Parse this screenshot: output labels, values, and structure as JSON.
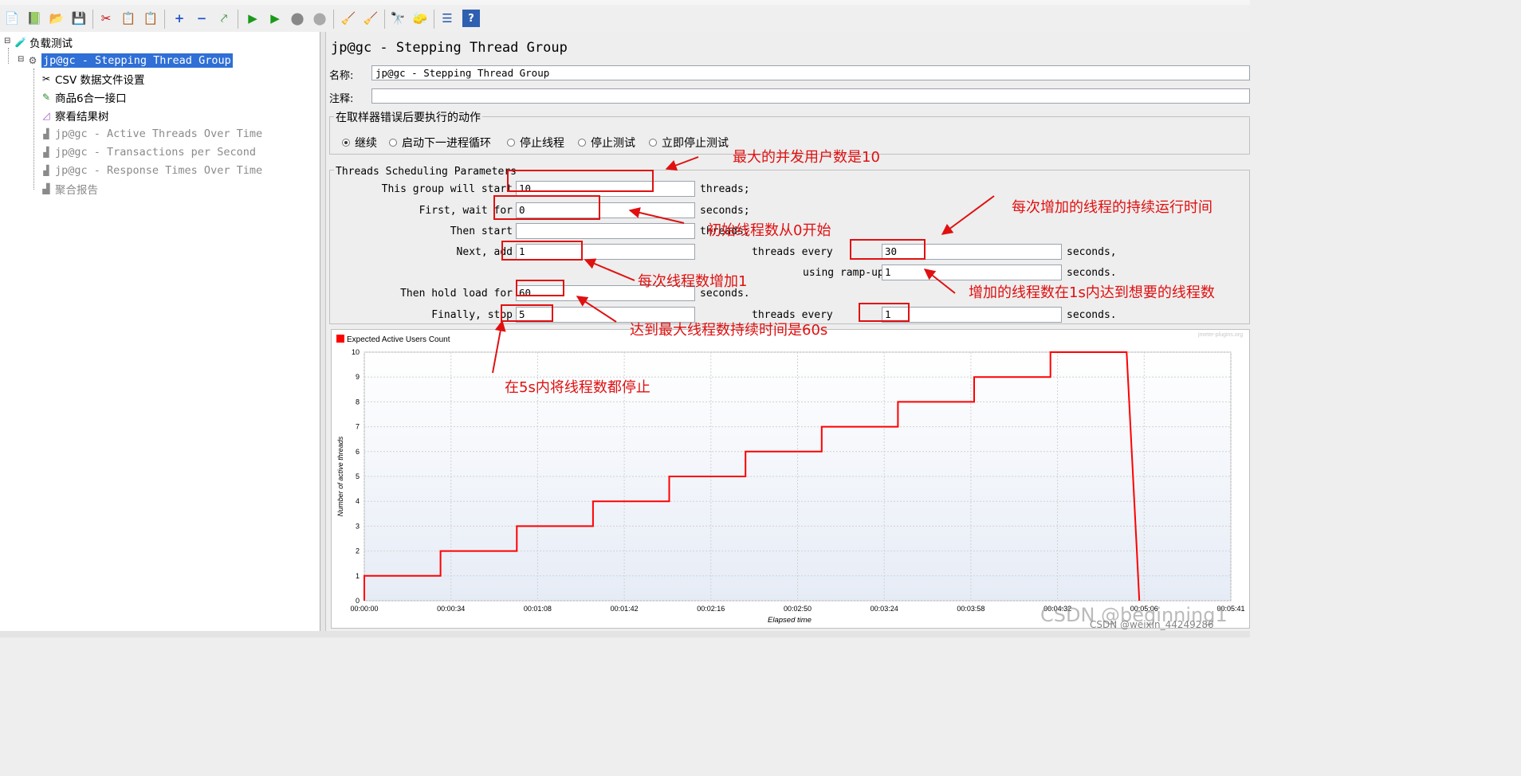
{
  "toolbar": {
    "icons": [
      "new-icon",
      "template-icon",
      "open-icon",
      "save-icon",
      "cut-icon",
      "copy-icon",
      "paste-icon",
      "expand-icon",
      "collapse-icon",
      "toggle-icon",
      "start-icon",
      "start-no-pause-icon",
      "stop-icon",
      "shutdown-icon",
      "clear-icon",
      "clear-all-icon",
      "search-icon",
      "reset-search-icon",
      "function-helper-icon",
      "help-icon"
    ]
  },
  "tree": {
    "root": "负载测试",
    "thread_group": "jp@gc - Stepping Thread Group",
    "children": [
      {
        "label": "CSV 数据文件设置",
        "icon": "csv-config-icon",
        "disabled": false
      },
      {
        "label": "商品6合一接口",
        "icon": "http-sampler-icon",
        "disabled": false
      },
      {
        "label": "察看结果树",
        "icon": "result-tree-icon",
        "disabled": false
      },
      {
        "label": "jp@gc - Active Threads Over Time",
        "icon": "graph-icon",
        "disabled": true
      },
      {
        "label": "jp@gc - Transactions per Second",
        "icon": "graph-icon",
        "disabled": true
      },
      {
        "label": "jp@gc - Response Times Over Time",
        "icon": "graph-icon",
        "disabled": true
      },
      {
        "label": "聚合报告",
        "icon": "graph-icon",
        "disabled": true
      }
    ]
  },
  "panel": {
    "title": "jp@gc - Stepping Thread Group",
    "name_label": "名称:",
    "name_value": "jp@gc - Stepping Thread Group",
    "comment_label": "注释:",
    "comment_value": "",
    "error_group_title": "在取样器错误后要执行的动作",
    "error_actions": [
      {
        "label": "继续",
        "selected": true
      },
      {
        "label": "启动下一进程循环",
        "selected": false
      },
      {
        "label": "停止线程",
        "selected": false
      },
      {
        "label": "停止测试",
        "selected": false
      },
      {
        "label": "立即停止测试",
        "selected": false
      }
    ],
    "sched_title": "Threads Scheduling Parameters",
    "params": {
      "start_label": "This group will start",
      "start_value": "10",
      "start_unit": "threads;",
      "wait_label": "First, wait for",
      "wait_value": "0",
      "wait_unit": "seconds;",
      "then_start_label": "Then start",
      "then_start_value": "",
      "then_start_unit": "threads;",
      "next_add_label": "Next, add",
      "next_add_value": "1",
      "threads_every_label": "threads every",
      "threads_every_value": "30",
      "threads_every_unit": "seconds,",
      "rampup_label": "using ramp-up",
      "rampup_value": "1",
      "rampup_unit": "seconds.",
      "hold_label": "Then hold load for",
      "hold_value": "60",
      "hold_unit": "seconds.",
      "stop_label": "Finally, stop",
      "stop_value": "5",
      "stop_every_label": "threads every",
      "stop_every_value": "1",
      "stop_every_unit": "seconds."
    }
  },
  "chart_data": {
    "type": "line",
    "legend": "Expected Active Users Count",
    "series_color": "#ff0000",
    "watermark": "jmeter-plugins.org",
    "xlabel": "Elapsed time",
    "ylabel": "Number of active threads",
    "ylim": [
      0,
      10
    ],
    "x_ticks": [
      "00:00:00",
      "00:00:34",
      "00:01:08",
      "00:01:42",
      "00:02:16",
      "00:02:50",
      "00:03:24",
      "00:03:58",
      "00:04:32",
      "00:05:06",
      "00:05:41"
    ],
    "x_seconds": [
      0,
      0,
      30,
      30,
      60,
      60,
      90,
      90,
      120,
      120,
      150,
      150,
      180,
      180,
      210,
      210,
      240,
      240,
      270,
      270,
      300,
      300,
      301,
      302,
      303,
      304,
      305
    ],
    "y": [
      0,
      1,
      1,
      2,
      2,
      3,
      3,
      4,
      4,
      5,
      5,
      6,
      6,
      7,
      7,
      8,
      8,
      9,
      9,
      10,
      10,
      10,
      8,
      6,
      4,
      2,
      0
    ],
    "x_max_seconds": 341
  },
  "annotations": {
    "a1": "最大的并发用户数是10",
    "a2": "每次增加的线程的持续运行时间",
    "a3": "初始线程数从0开始",
    "a4": "每次线程数增加1",
    "a5": "增加的线程数在1s内达到想要的线程数",
    "a6": "达到最大线程数持续时间是60s",
    "a7": "在5s内将线程数都停止"
  },
  "watermark_text": "CSDN @beginning1",
  "watermark_text2": "CSDN @weixin_44249286"
}
